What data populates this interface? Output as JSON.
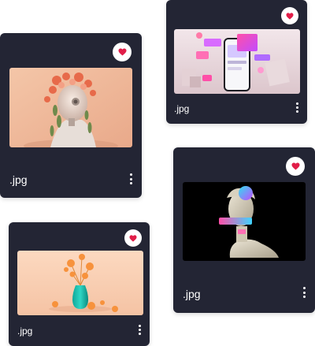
{
  "colors": {
    "card_background": "#232534",
    "favorite_button_background": "#ffffff",
    "favorite_heart": "#e11d48",
    "text": "#ffffff"
  },
  "cards": [
    {
      "filename": ".jpg",
      "favorite_icon": "heart-icon",
      "menu_icon": "kebab-menu-icon",
      "image": "robot-head-with-flowers"
    },
    {
      "filename": ".jpg",
      "favorite_icon": "heart-icon",
      "menu_icon": "kebab-menu-icon",
      "image": "smartphone-with-floating-shapes"
    },
    {
      "filename": ".jpg",
      "favorite_icon": "heart-icon",
      "menu_icon": "kebab-menu-icon",
      "image": "classical-bust-with-colorful-shapes"
    },
    {
      "filename": ".jpg",
      "favorite_icon": "heart-icon",
      "menu_icon": "kebab-menu-icon",
      "image": "vase-with-orange-spheres"
    }
  ]
}
